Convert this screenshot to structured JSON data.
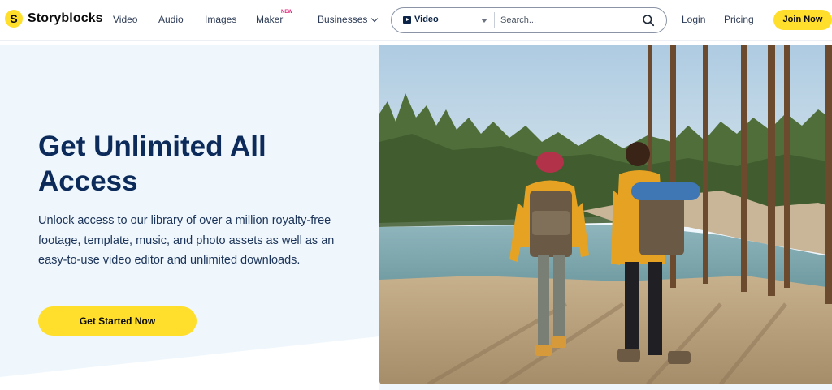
{
  "brand": {
    "name": "Storyblocks",
    "mark": "S"
  },
  "nav": {
    "links": [
      "Video",
      "Audio",
      "Images",
      "Maker",
      "Businesses"
    ],
    "maker_badge": "NEW",
    "login": "Login",
    "pricing": "Pricing",
    "join": "Join Now"
  },
  "search": {
    "type": "Video",
    "placeholder": "Search..."
  },
  "hero": {
    "title": "Get Unlimited All Access",
    "description": "Unlock access to our library of over a million royalty-free footage, template, music, and photo assets as well as an easy-to-use video editor and unlimited downloads.",
    "cta": "Get Started Now"
  },
  "colors": {
    "accent": "#ffdf2b",
    "heading": "#0c2b5a",
    "hero_bg": "#eff7fd",
    "badge": "#e0267a"
  },
  "icons": [
    "storyblocks-logo-icon",
    "chevron-down-icon",
    "video-play-icon",
    "caret-down-icon",
    "search-icon"
  ]
}
